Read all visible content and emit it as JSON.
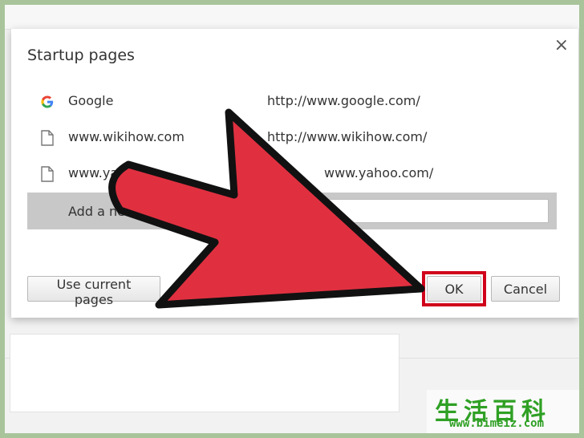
{
  "dialog": {
    "title": "Startup pages",
    "close_symbol": "×",
    "pages": [
      {
        "icon": "google-icon",
        "name": "Google",
        "url": "http://www.google.com/"
      },
      {
        "icon": "page-icon",
        "name": "www.wikihow.com",
        "url": "http://www.wikihow.com/"
      },
      {
        "icon": "page-icon",
        "name": "www.ya",
        "url": "www.yahoo.com/"
      }
    ],
    "add_new_label": "Add a new",
    "add_new_value": "",
    "buttons": {
      "use_current": "Use current pages",
      "ok": "OK",
      "cancel": "Cancel"
    }
  },
  "overlay": {
    "arrow_color": "#e03040",
    "highlight_color": "#d0021b"
  },
  "watermark": {
    "chars": "生活百科",
    "url": "www.bimeiz.com",
    "color": "#2fa024"
  }
}
